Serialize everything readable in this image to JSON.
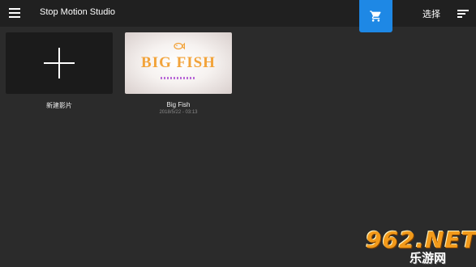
{
  "toolbar": {
    "title": "Stop Motion Studio",
    "menu_icon": "hamburger-menu-icon",
    "cart_icon": "shopping-cart-icon",
    "select_label": "选择",
    "sort_icon": "sort-icon",
    "accent_color": "#1e88e5"
  },
  "projects": {
    "new_movie_label": "新建影片",
    "items": [
      {
        "title": "Big Fish",
        "date": "2018/5/22 - 03:13",
        "thumbnail_text": "BIG FISH"
      }
    ]
  },
  "watermark": {
    "logo": "962.NET",
    "sub": "乐游网"
  }
}
